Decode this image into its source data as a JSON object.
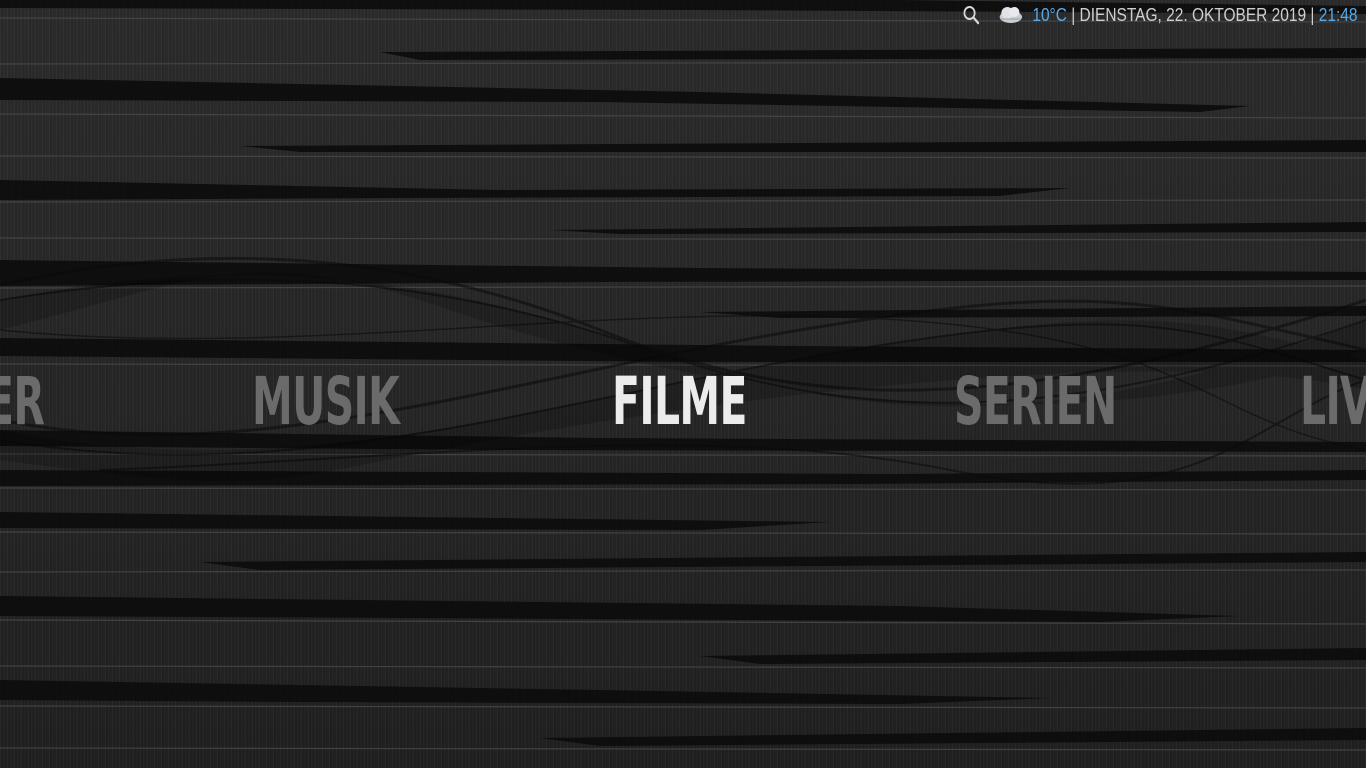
{
  "top_bar": {
    "search_icon": "search-icon",
    "weather_icon": "cloud-weather-icon",
    "temperature": "10°C",
    "separator": "|",
    "date": "DIENSTAG, 22. OKTOBER 2019",
    "time": "21:48",
    "accent_color": "#5aa9e6"
  },
  "main_menu": {
    "items": [
      {
        "label": "ER",
        "state": "partial"
      },
      {
        "label": "MUSIK",
        "state": "inactive"
      },
      {
        "label": "FILME",
        "state": "active"
      },
      {
        "label": "SERIEN",
        "state": "inactive"
      },
      {
        "label": "LIV",
        "state": "partial"
      }
    ],
    "active_color": "#ececec",
    "inactive_color": "#6b6b6b"
  }
}
